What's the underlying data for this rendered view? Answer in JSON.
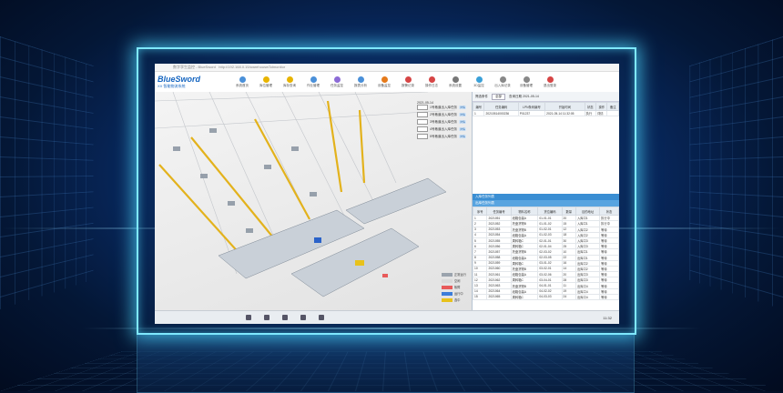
{
  "app": {
    "logo": "BlueSword",
    "logo_sub": "XX 智能物流系统",
    "browser_tab": "数字孪生监控 - BlueSword",
    "url": "http://192.168.0.15/warehouse/3dmonitor"
  },
  "toolbar": {
    "items": [
      {
        "label": "系统首页",
        "color": "#4a90d9"
      },
      {
        "label": "库位管理",
        "color": "#e8b400"
      },
      {
        "label": "库存查询",
        "color": "#e8b400"
      },
      {
        "label": "作业管理",
        "color": "#4a90d9"
      },
      {
        "label": "任务监控",
        "color": "#8c6bd6"
      },
      {
        "label": "报表分析",
        "color": "#4a90d9"
      },
      {
        "label": "设备监控",
        "color": "#e57a1b"
      },
      {
        "label": "报警记录",
        "color": "#d64545"
      },
      {
        "label": "操作日志",
        "color": "#d64545"
      },
      {
        "label": "系统设置",
        "color": "#777"
      },
      {
        "label": "3D监控",
        "color": "#3aa0d8"
      },
      {
        "label": "出入库记录",
        "color": "#888"
      },
      {
        "label": "设备管理",
        "color": "#888"
      },
      {
        "label": "退出登录",
        "color": "#d64545"
      }
    ]
  },
  "view3d": {
    "time": "2021-05-14",
    "layers": [
      {
        "label": "1号巷道出入库任务",
        "btn": "详情"
      },
      {
        "label": "2号巷道出入库任务",
        "btn": "详情"
      },
      {
        "label": "3号巷道出入库任务",
        "btn": "详情"
      },
      {
        "label": "4号巷道出入库任务",
        "btn": "详情"
      },
      {
        "label": "5号巷道出入库任务",
        "btn": "详情"
      }
    ],
    "color_legend": [
      {
        "label": "正常运行",
        "color": "#9aa3ad"
      },
      {
        "label": "空闲",
        "color": "#d9d9d9"
      },
      {
        "label": "故障",
        "color": "#e85a5a"
      },
      {
        "label": "运行中",
        "color": "#3c7dd9"
      },
      {
        "label": "选中",
        "color": "#e8c21b"
      }
    ]
  },
  "panel": {
    "filter_label": "筛选条件",
    "filter_value": "全部",
    "date_label": "查询日期 2021-05-14",
    "top_headers": [
      "编号",
      "任务编码",
      "LPN条码编号",
      "开始时间",
      "状态",
      "操作",
      "备注"
    ],
    "top_rows": [
      [
        "1",
        "20210514000236",
        "P01237",
        "2021-05-14 11:32:05",
        "执行",
        "详情",
        ""
      ]
    ],
    "section1": "入库任务列表",
    "section2": "出库任务列表",
    "bottom_headers": [
      "序号",
      "任务编号",
      "物料名称",
      "货位编码",
      "数量",
      "目的地址",
      "状态"
    ],
    "bottom_rows": [
      [
        "1",
        "2021051",
        "纸箱包装A",
        "01-01-01",
        "20",
        "入库口1",
        "执行中"
      ],
      [
        "2",
        "2021052",
        "托盘货物B",
        "01-01-02",
        "15",
        "入库口1",
        "执行中"
      ],
      [
        "3",
        "2021053",
        "托盘货物B",
        "01-02-01",
        "12",
        "入库口2",
        "等待"
      ],
      [
        "4",
        "2021054",
        "纸箱包装A",
        "01-02-03",
        "18",
        "入库口2",
        "等待"
      ],
      [
        "5",
        "2021055",
        "周转箱C",
        "02-01-01",
        "30",
        "入库口3",
        "等待"
      ],
      [
        "6",
        "2021056",
        "周转箱C",
        "02-01-04",
        "25",
        "入库口3",
        "等待"
      ],
      [
        "7",
        "2021057",
        "托盘货物B",
        "02-03-02",
        "10",
        "出库口1",
        "等待"
      ],
      [
        "8",
        "2021058",
        "纸箱包装A",
        "02-03-05",
        "22",
        "出库口1",
        "等待"
      ],
      [
        "9",
        "2021059",
        "周转箱C",
        "03-01-02",
        "16",
        "出库口2",
        "等待"
      ],
      [
        "10",
        "2021060",
        "托盘货物B",
        "03-02-01",
        "14",
        "出库口2",
        "等待"
      ],
      [
        "11",
        "2021061",
        "纸箱包装A",
        "03-02-06",
        "20",
        "出库口3",
        "等待"
      ],
      [
        "12",
        "2021062",
        "周转箱C",
        "03-04-01",
        "28",
        "出库口3",
        "等待"
      ],
      [
        "13",
        "2021063",
        "托盘货物B",
        "04-01-01",
        "11",
        "出库口4",
        "等待"
      ],
      [
        "14",
        "2021064",
        "纸箱包装A",
        "04-02-02",
        "19",
        "出库口4",
        "等待"
      ],
      [
        "15",
        "2021065",
        "周转箱C",
        "04-03-03",
        "24",
        "出库口4",
        "等待"
      ]
    ]
  },
  "taskbar": {
    "icons": [
      "start-icon",
      "search-icon",
      "folder-icon",
      "browser-icon",
      "app-icon"
    ],
    "clock": "11:32"
  }
}
